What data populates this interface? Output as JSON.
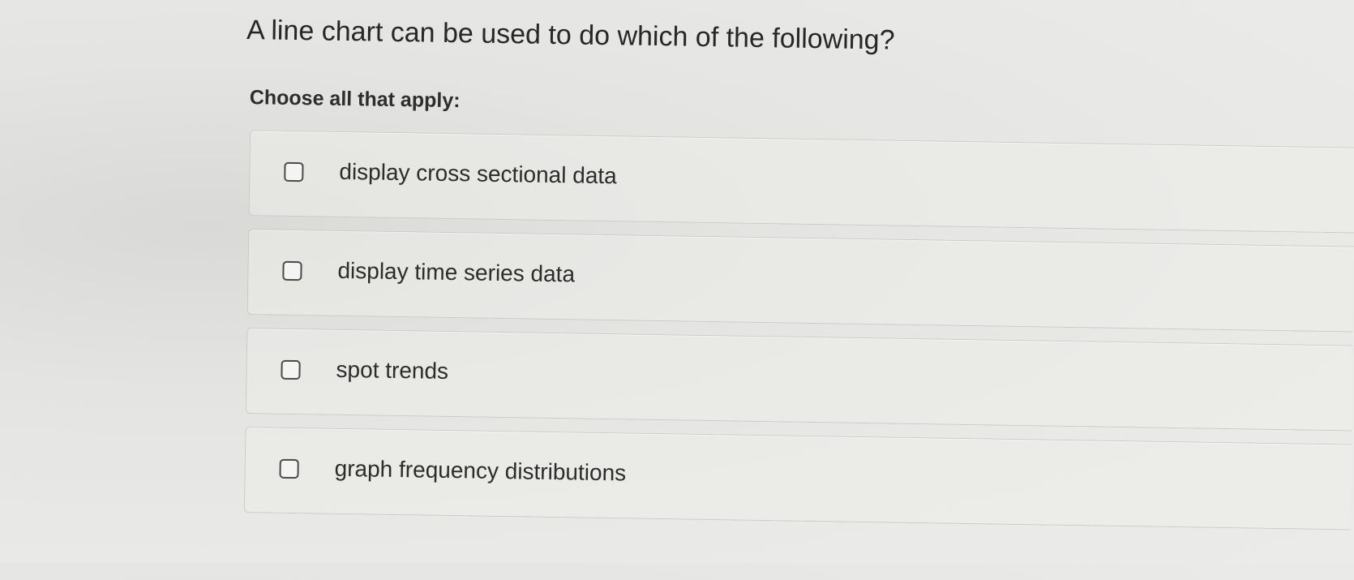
{
  "question": {
    "text": "A line chart can be used to do which of the following?",
    "instructions": "Choose all that apply:"
  },
  "options": [
    {
      "label": "display cross sectional data",
      "checked": false
    },
    {
      "label": "display time series data",
      "checked": false
    },
    {
      "label": "spot trends",
      "checked": false
    },
    {
      "label": "graph frequency distributions",
      "checked": false
    }
  ]
}
